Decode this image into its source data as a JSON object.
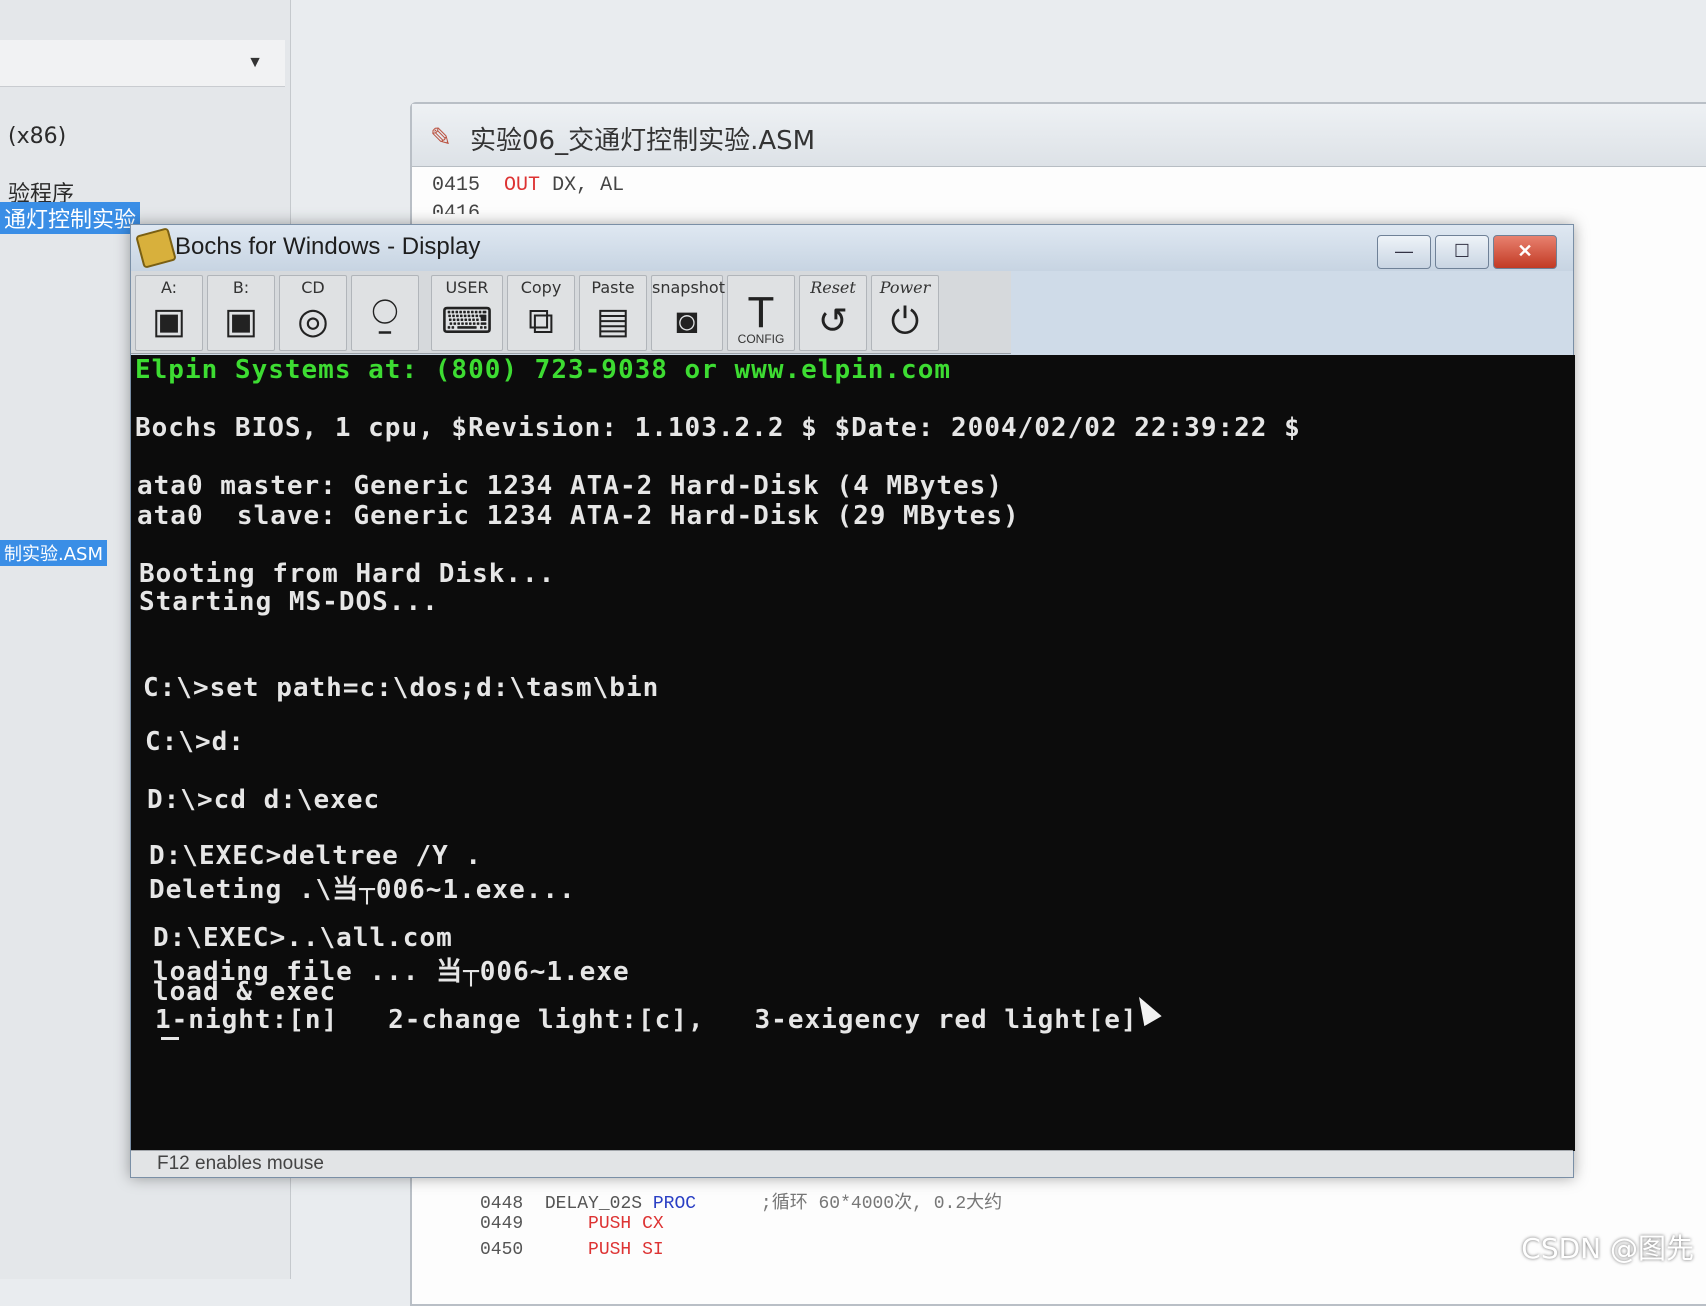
{
  "ide": {
    "left_items": [
      "(x86)",
      "验程序",
      "通灯控制实验",
      "制实验.ASM"
    ],
    "editor_tab_title": "实验06_交通灯控制实验.ASM",
    "code_top": [
      {
        "num": "0415",
        "op": "OUT",
        "args": "DX, AL"
      },
      {
        "num": "0416",
        "op": "",
        "args": ""
      }
    ],
    "code_bottom": [
      {
        "num": "0448",
        "label": "DELAY_02S",
        "op": "PROC",
        "comment": ";循环 60*4000次, 0.2大约"
      },
      {
        "num": "0449",
        "label": "",
        "op": "PUSH",
        "args": "CX"
      },
      {
        "num": "0450",
        "label": "",
        "op": "PUSH",
        "args": "SI"
      }
    ]
  },
  "bochs": {
    "title": "Bochs for Windows - Display",
    "toolbar": {
      "floppy_a": "A:",
      "floppy_b": "B:",
      "cdrom": "CD",
      "user": "USER",
      "copy": "Copy",
      "paste": "Paste",
      "snapshot": "snapshot",
      "config": "CONFIG",
      "reset": "Reset",
      "power": "Power"
    },
    "screen_lines": [
      "Elpin Systems at: (800) 723-9038 or www.elpin.com",
      "Bochs BIOS, 1 cpu, $Revision: 1.103.2.2 $ $Date: 2004/02/02 22:39:22 $",
      "ata0 master: Generic 1234 ATA-2 Hard-Disk (4 MBytes)",
      "ata0  slave: Generic 1234 ATA-2 Hard-Disk (29 MBytes)",
      "Booting from Hard Disk...",
      "Starting MS-DOS...",
      "C:\\>set path=c:\\dos;d:\\tasm\\bin",
      "C:\\>d:",
      "D:\\>cd d:\\exec",
      "D:\\EXEC>deltree /Y .",
      "Deleting .\\当┬006~1.exe...",
      "D:\\EXEC>..\\all.com",
      "loading file ... 当┬006~1.exe",
      "load & exec",
      "1-night:[n]   2-change light:[c],   3-exigency red light[e]"
    ],
    "status": "F12 enables mouse"
  },
  "watermark": "CSDN @图先"
}
